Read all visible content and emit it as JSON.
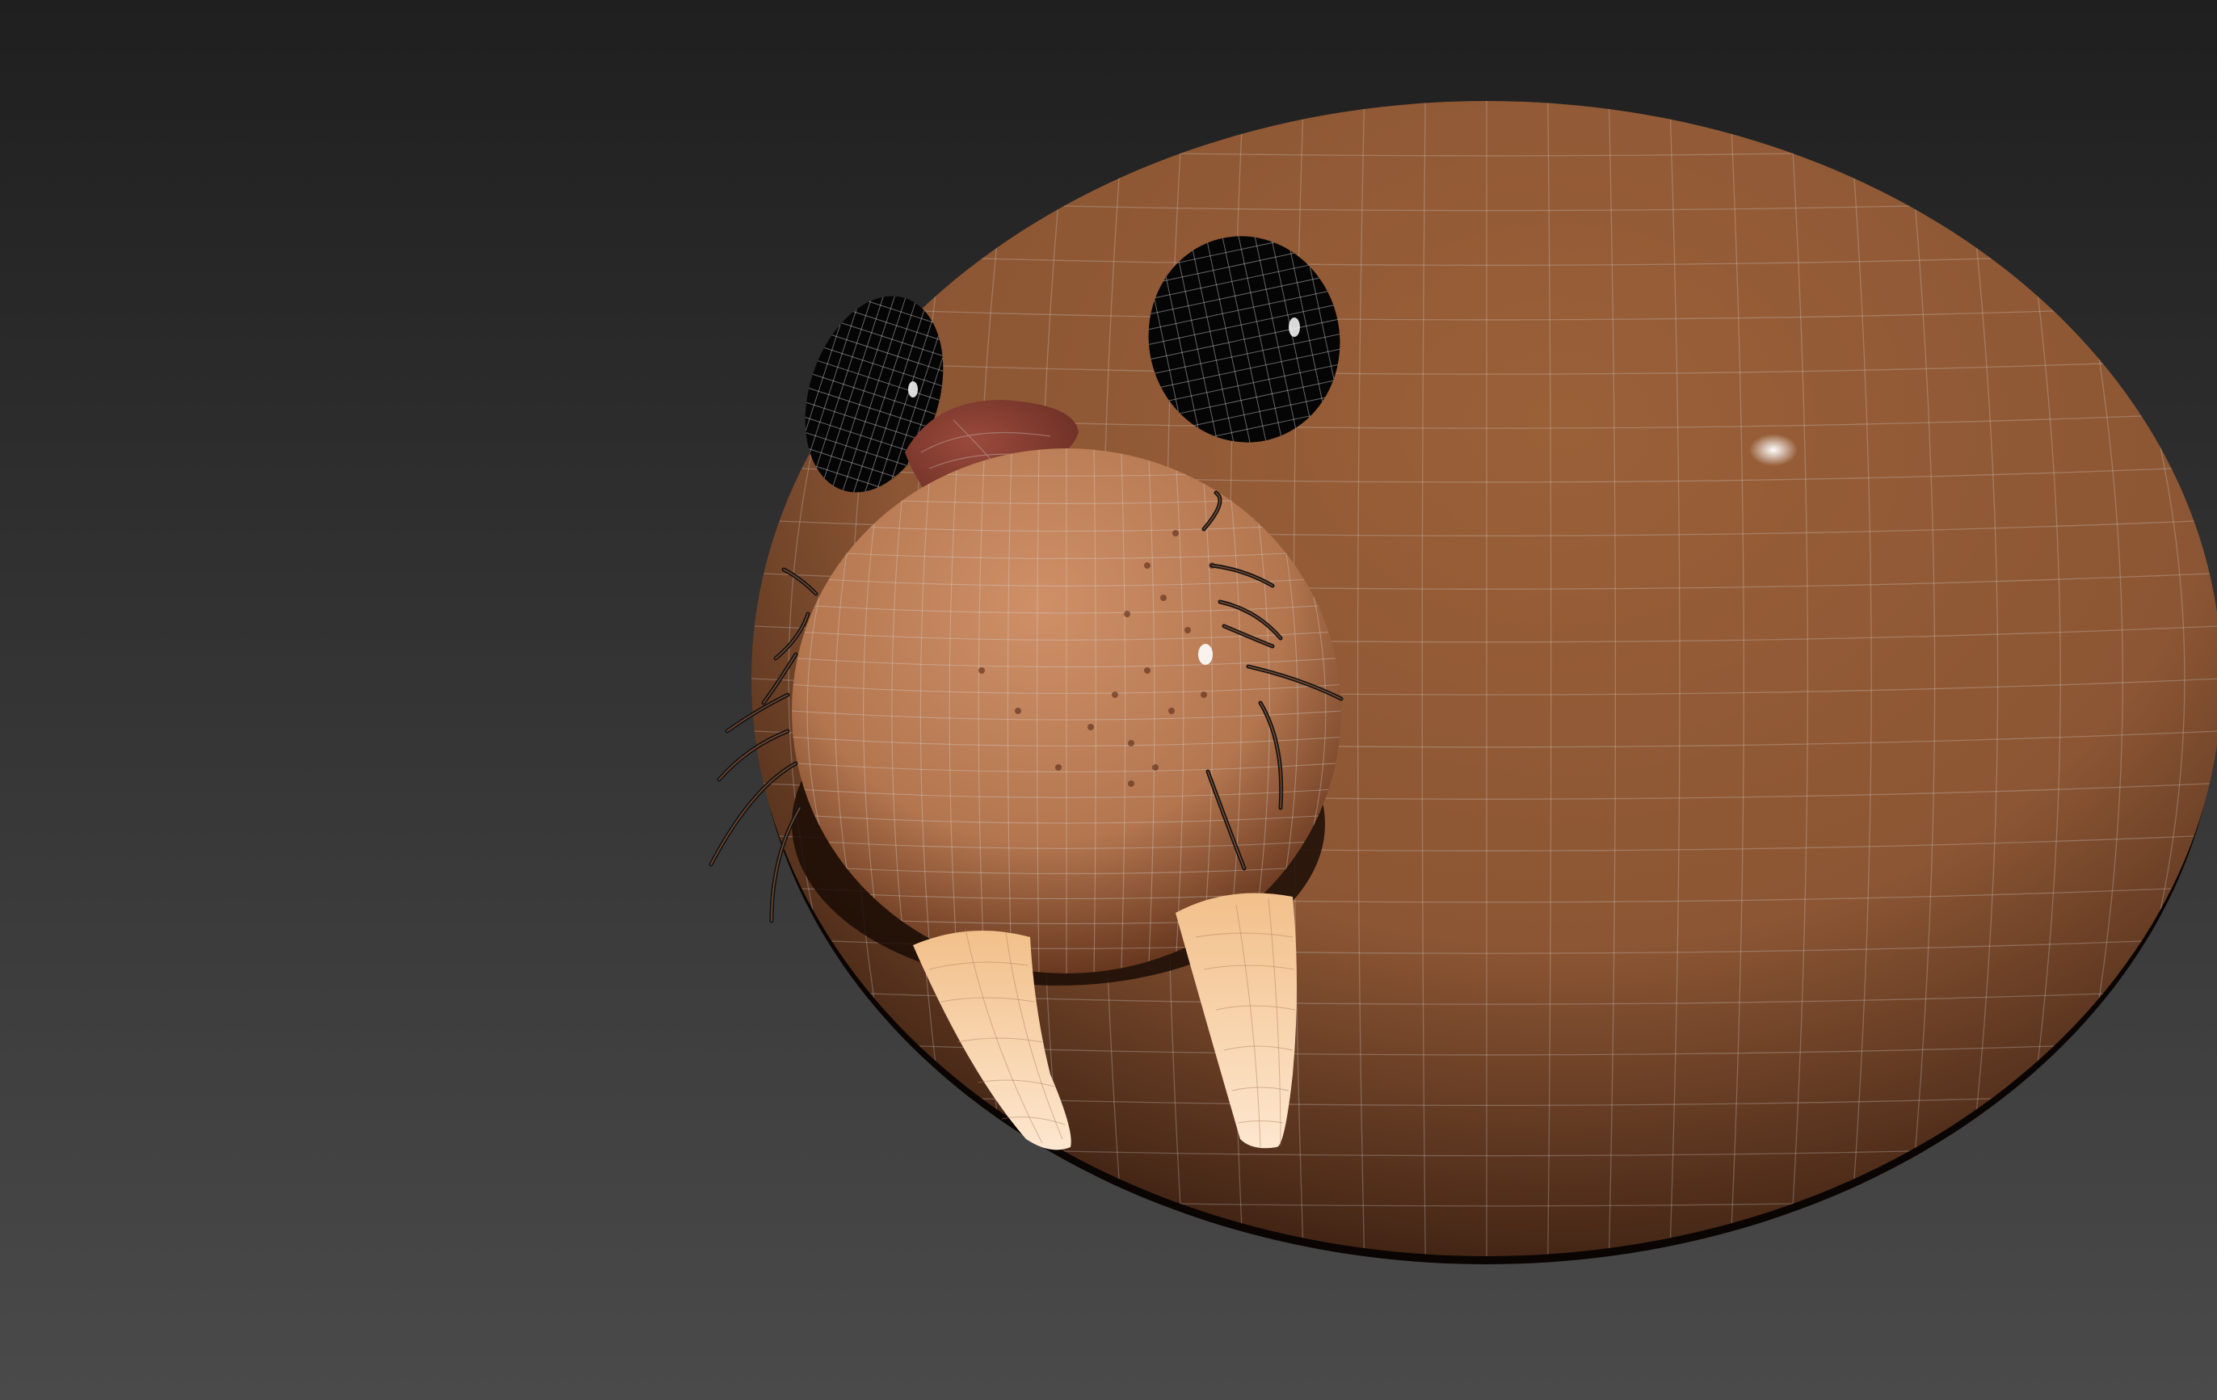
{
  "viewport": {
    "background_top": "#1f1f1f",
    "background_bottom": "#4a4a4a"
  },
  "model": {
    "subject": "walrus-head",
    "body_color": "#8c5634",
    "body_dark": "#2a140a",
    "muzzle_color": "#b3764f",
    "nose_color": "#6b2e24",
    "eye_color": "#050505",
    "tusk_color": "#f2c08a",
    "tusk_tip": "#fde7cf",
    "whisker_color": "#141414",
    "wireframe_color": "#d9d9d9",
    "wireframe_visible": true
  }
}
